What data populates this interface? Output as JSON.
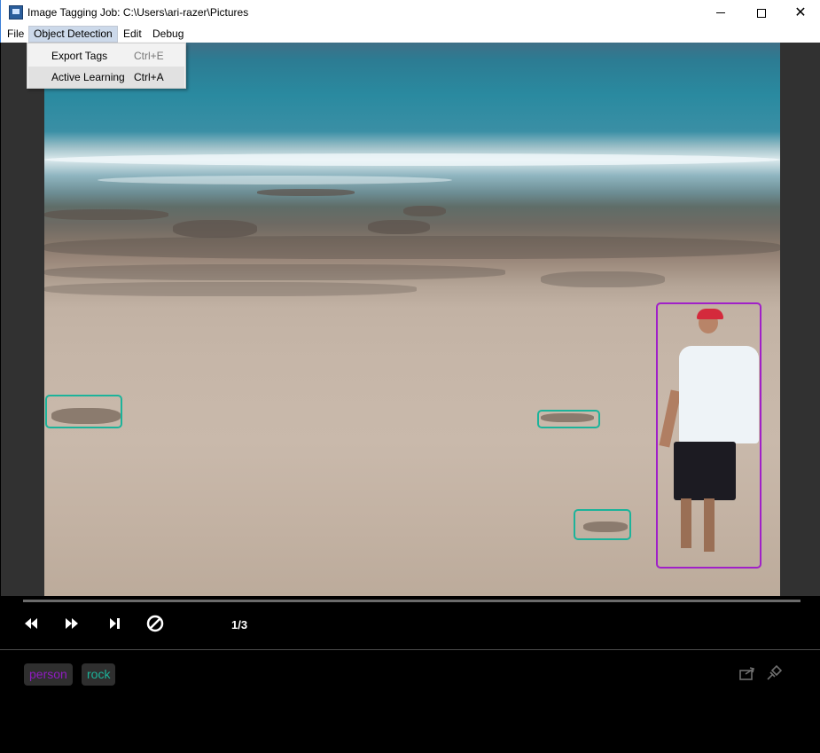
{
  "window": {
    "title": "Image Tagging Job: C:\\Users\\ari-razer\\Pictures",
    "controls": [
      "minimize-icon",
      "maximize-icon",
      "close-icon"
    ]
  },
  "menubar": {
    "file": "File",
    "object_detection": "Object Detection",
    "edit": "Edit",
    "debug": "Debug"
  },
  "dropdown": {
    "items": [
      {
        "label": "Export Tags",
        "shortcut": "Ctrl+E",
        "enabled": false
      },
      {
        "label": "Active Learning",
        "shortcut": "Ctrl+A",
        "enabled": true
      }
    ]
  },
  "canvas": {
    "boxes": [
      {
        "tag": "rock",
        "color": "#1cb39a"
      },
      {
        "tag": "rock",
        "color": "#1cb39a"
      },
      {
        "tag": "rock",
        "color": "#1cb39a"
      },
      {
        "tag": "person",
        "color": "#a020c8"
      }
    ]
  },
  "player": {
    "frame_counter": "1/3",
    "buttons": [
      "rewind-icon",
      "fast-forward-icon",
      "skip-next-icon",
      "clear-icon"
    ]
  },
  "tags": {
    "items": [
      {
        "label": "person",
        "color": "#8f1cc0"
      },
      {
        "label": "rock",
        "color": "#1cb39a"
      }
    ],
    "actions": [
      "export-icon",
      "pin-icon"
    ]
  }
}
